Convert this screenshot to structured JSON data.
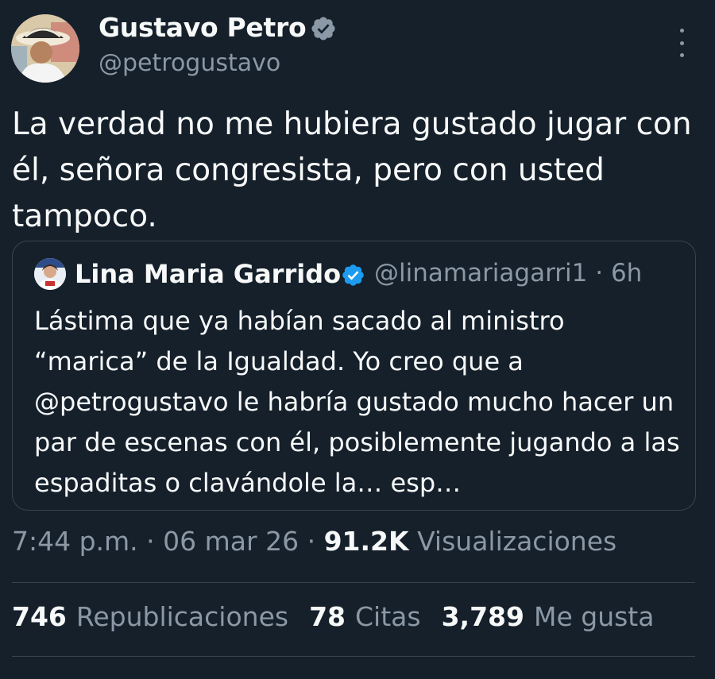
{
  "author": {
    "name": "Gustavo Petro",
    "handle": "@petrogustavo",
    "verified": true
  },
  "tweet": {
    "text": "La verdad no me hubiera gustado jugar con él, señora congresista, pero con usted tampoco."
  },
  "quoted": {
    "name": "Lina Maria Garrido",
    "handle": "@linamariagarri1",
    "separator": "·",
    "time": "6h",
    "text": "Lástima que ya habían sacado al ministro “marica” de la Igualdad. Yo creo que a @petrogustavo le habría gustado mucho hacer un par de escenas con él, posiblemente jugando a las espaditas o clavándole la… esp…"
  },
  "meta": {
    "time": "7:44 p.m.",
    "date": "06 mar 26",
    "separator": "·",
    "views_count": "91.2K",
    "views_label": "Visualizaciones"
  },
  "stats": {
    "reposts_count": "746",
    "reposts_label": "Republicaciones",
    "quotes_count": "78",
    "quotes_label": "Citas",
    "likes_count": "3,789",
    "likes_label": "Me gusta"
  },
  "icons": {
    "verified": "verified-badge-icon",
    "more": "more-dots-vertical-icon"
  },
  "colors": {
    "background": "#15202b",
    "text": "#f7f9f9",
    "secondary": "#8b98a5",
    "border": "#38444d",
    "verified": "#1d9bf0"
  }
}
